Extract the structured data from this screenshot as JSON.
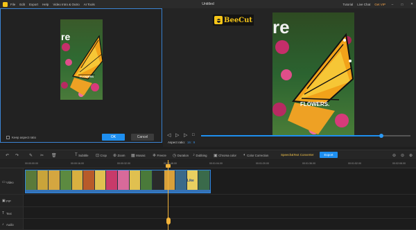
{
  "titlebar": {
    "menu": [
      "File",
      "Edit",
      "Export",
      "Help",
      "Video Intro & Outro",
      "AI Tools"
    ],
    "title": "Untitled",
    "right": [
      "Tutorial",
      "Live Chat"
    ],
    "vip": "Get VIP"
  },
  "crop": {
    "keep_aspect": "Keep aspect ratio",
    "ok": "OK",
    "cancel": "Cancel",
    "thumb_text": "re",
    "thumb_caption": "FLOWERS"
  },
  "preview": {
    "watermark": "BeeCut",
    "overlay_text": "re",
    "caption": "FLOWERS.",
    "aspect_label": "Aspect ratio:",
    "aspect_value": "16 : 9",
    "progress": 0.86
  },
  "toolbar": {
    "items": [
      "Subtitle",
      "Crop",
      "Zoom",
      "Mosaic",
      "Freeze",
      "Duration",
      "Dubbing",
      "Chroma color",
      "Color Correction"
    ],
    "speech": "Speech&Text Converter",
    "export": "Export"
  },
  "timeline": {
    "ticks": [
      "00:00:00.00",
      "00:00:16.00",
      "00:00:32.00",
      "00:00:48.00",
      "00:01:04.00",
      "00:01:20.00",
      "00:01:36.00",
      "00:01:52.00",
      "00:02:08.00"
    ],
    "tracks": [
      "Video",
      "PIP",
      "Text",
      "Audio"
    ],
    "clip_text": "Like"
  },
  "colors": {
    "accent": "#1e8ff0",
    "playhead": "#f3b33a",
    "vip": "#f3a34a"
  }
}
